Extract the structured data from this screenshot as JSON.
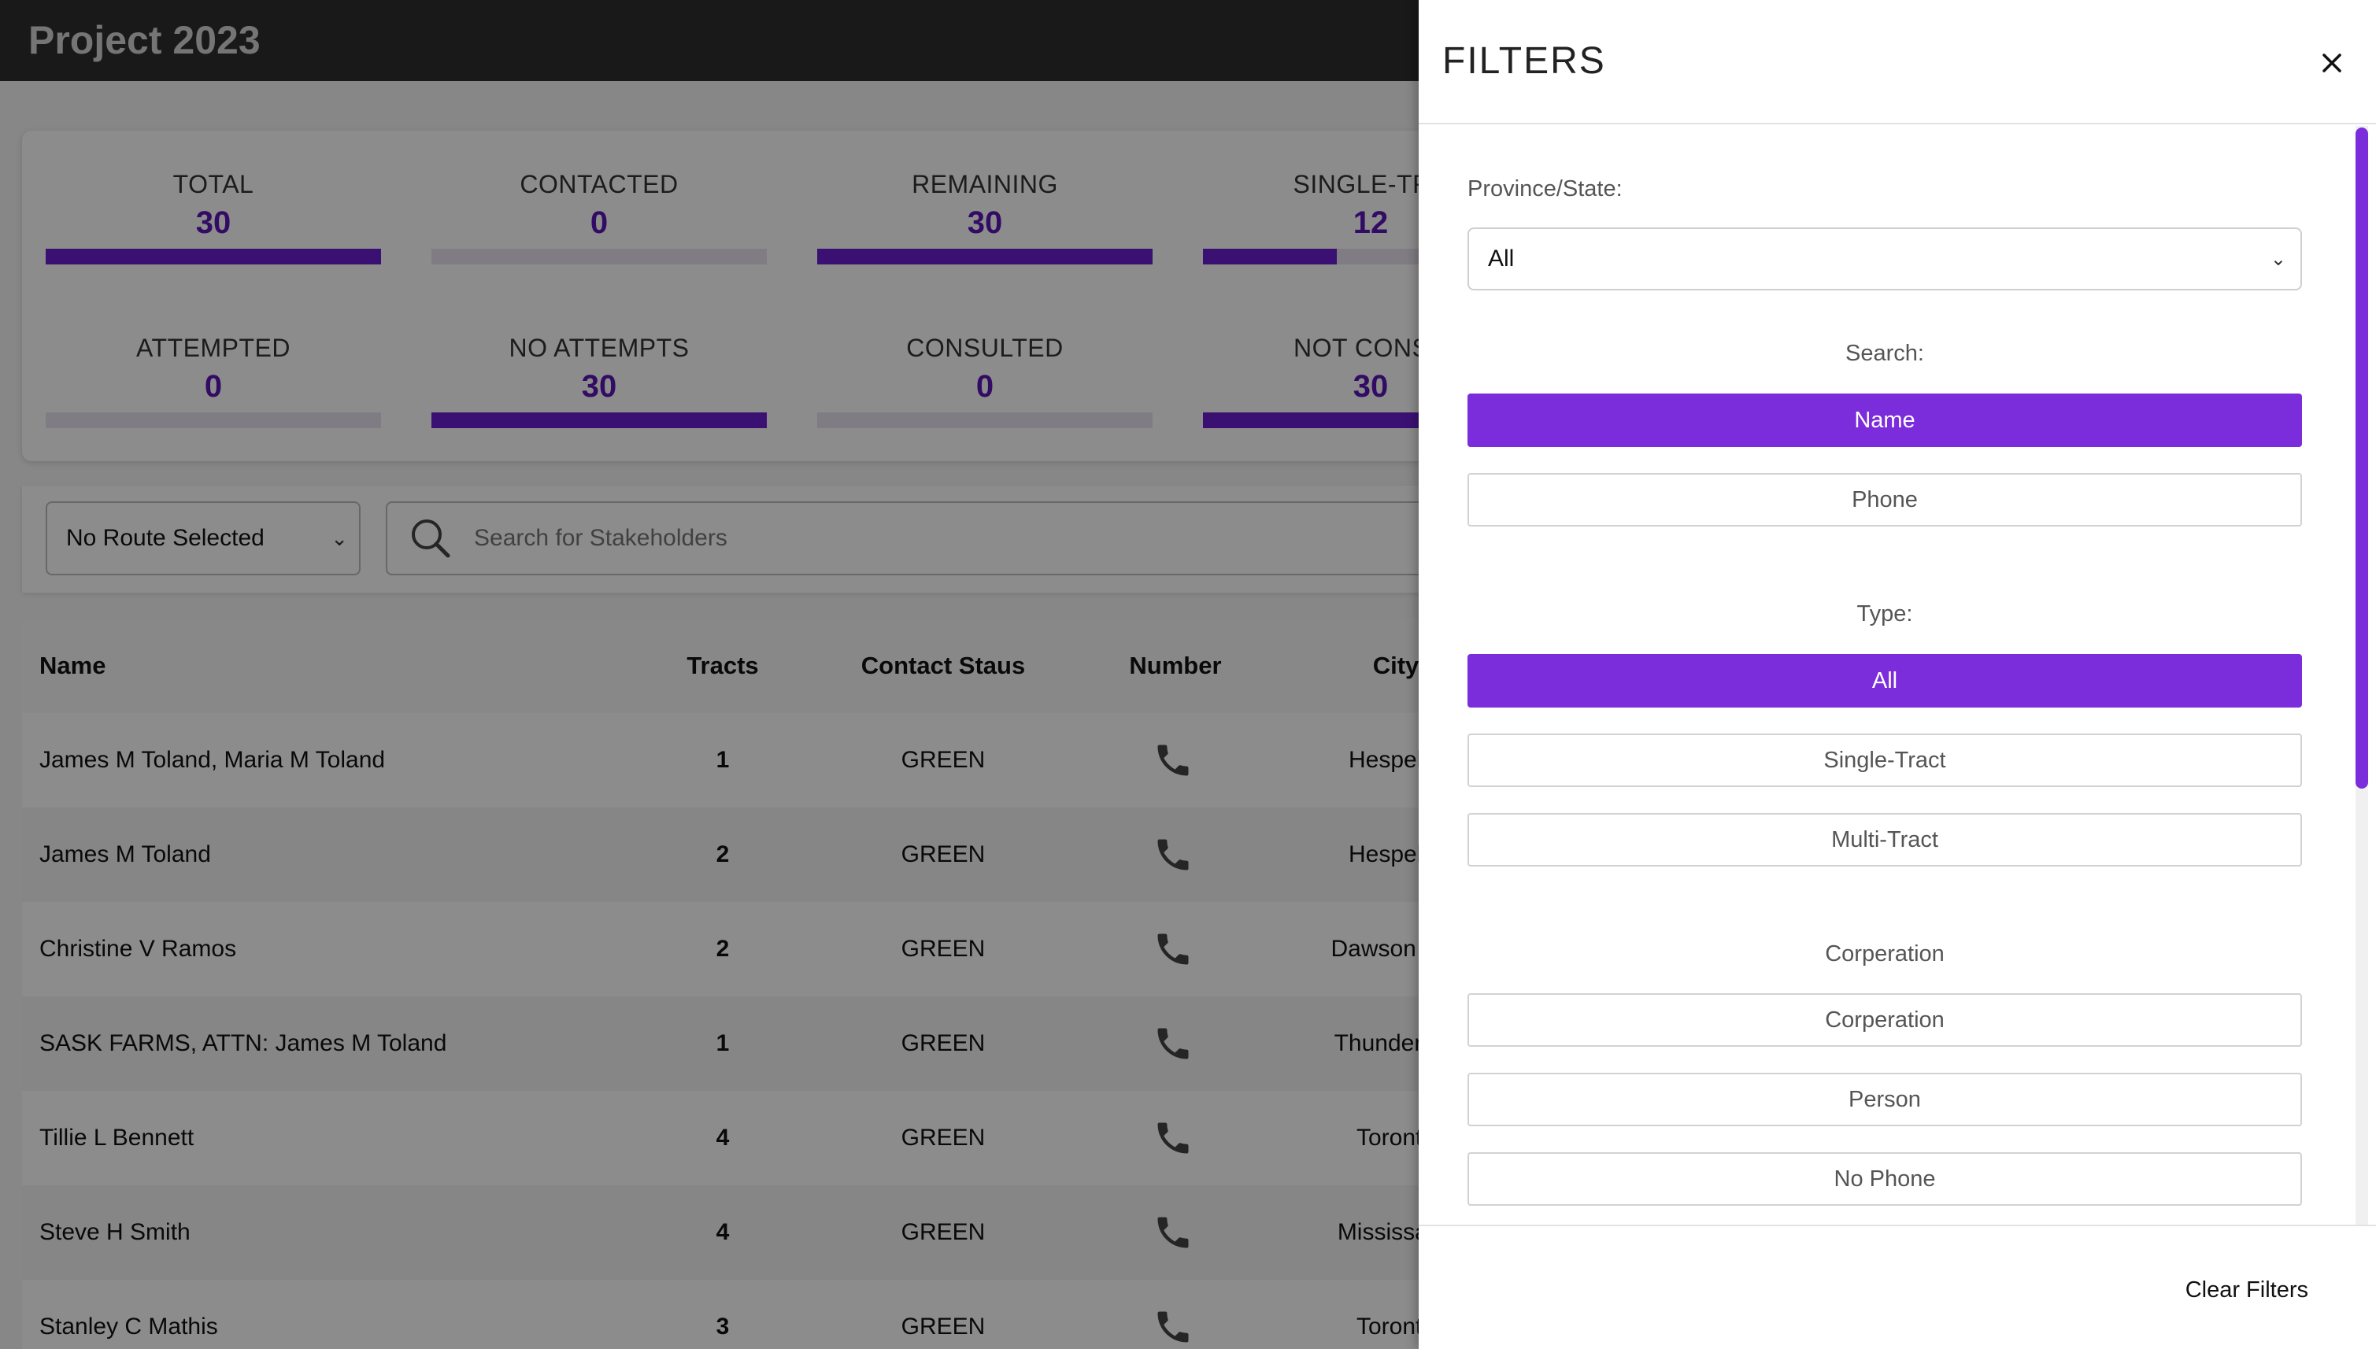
{
  "app": {
    "title": "Project 2023"
  },
  "stats": [
    {
      "label": "TOTAL",
      "value": "30",
      "fill": 1.0
    },
    {
      "label": "CONTACTED",
      "value": "0",
      "fill": 0.0
    },
    {
      "label": "REMAINING",
      "value": "30",
      "fill": 1.0
    },
    {
      "label": "SINGLE-TRA",
      "value": "12",
      "fill": 0.4
    },
    {
      "label": "ATTEMPTED",
      "value": "0",
      "fill": 0.0
    },
    {
      "label": "NO ATTEMPTS",
      "value": "30",
      "fill": 1.0
    },
    {
      "label": "CONSULTED",
      "value": "0",
      "fill": 0.0
    },
    {
      "label": "NOT CONSU",
      "value": "30",
      "fill": 1.0
    }
  ],
  "route_select": {
    "value": "No Route Selected"
  },
  "stakeholder_search": {
    "placeholder": "Search for Stakeholders"
  },
  "table": {
    "headers": {
      "name": "Name",
      "tracts": "Tracts",
      "contact_status": "Contact Staus",
      "number": "Number",
      "city": "City"
    },
    "rows": [
      {
        "name": "James M Toland, Maria M Toland",
        "tracts": "1",
        "status": "GREEN",
        "city": "Hespeler"
      },
      {
        "name": "James M Toland",
        "tracts": "2",
        "status": "GREEN",
        "city": "Hespeler"
      },
      {
        "name": "Christine V Ramos",
        "tracts": "2",
        "status": "GREEN",
        "city": "Dawson Cre"
      },
      {
        "name": "SASK FARMS, ATTN: James M Toland",
        "tracts": "1",
        "status": "GREEN",
        "city": "Thunder Ba"
      },
      {
        "name": "Tillie L Bennett",
        "tracts": "4",
        "status": "GREEN",
        "city": "Toronto"
      },
      {
        "name": "Steve H Smith",
        "tracts": "4",
        "status": "GREEN",
        "city": "Mississaug"
      },
      {
        "name": "Stanley C Mathis",
        "tracts": "3",
        "status": "GREEN",
        "city": "Toronto"
      }
    ]
  },
  "filters": {
    "title": "FILTERS",
    "province_label": "Province/State:",
    "province_value": "All",
    "search_label": "Search:",
    "search_options": [
      "Name",
      "Phone"
    ],
    "type_label": "Type:",
    "type_options": [
      "All",
      "Single-Tract",
      "Multi-Tract"
    ],
    "corp_label": "Corperation",
    "corp_options": [
      "Corperation",
      "Person",
      "No Phone"
    ],
    "clear_label": "Clear Filters"
  },
  "colors": {
    "accent": "#7b2cdb",
    "stat_value": "#5b16b6",
    "topbar": "#2e2e2e"
  }
}
